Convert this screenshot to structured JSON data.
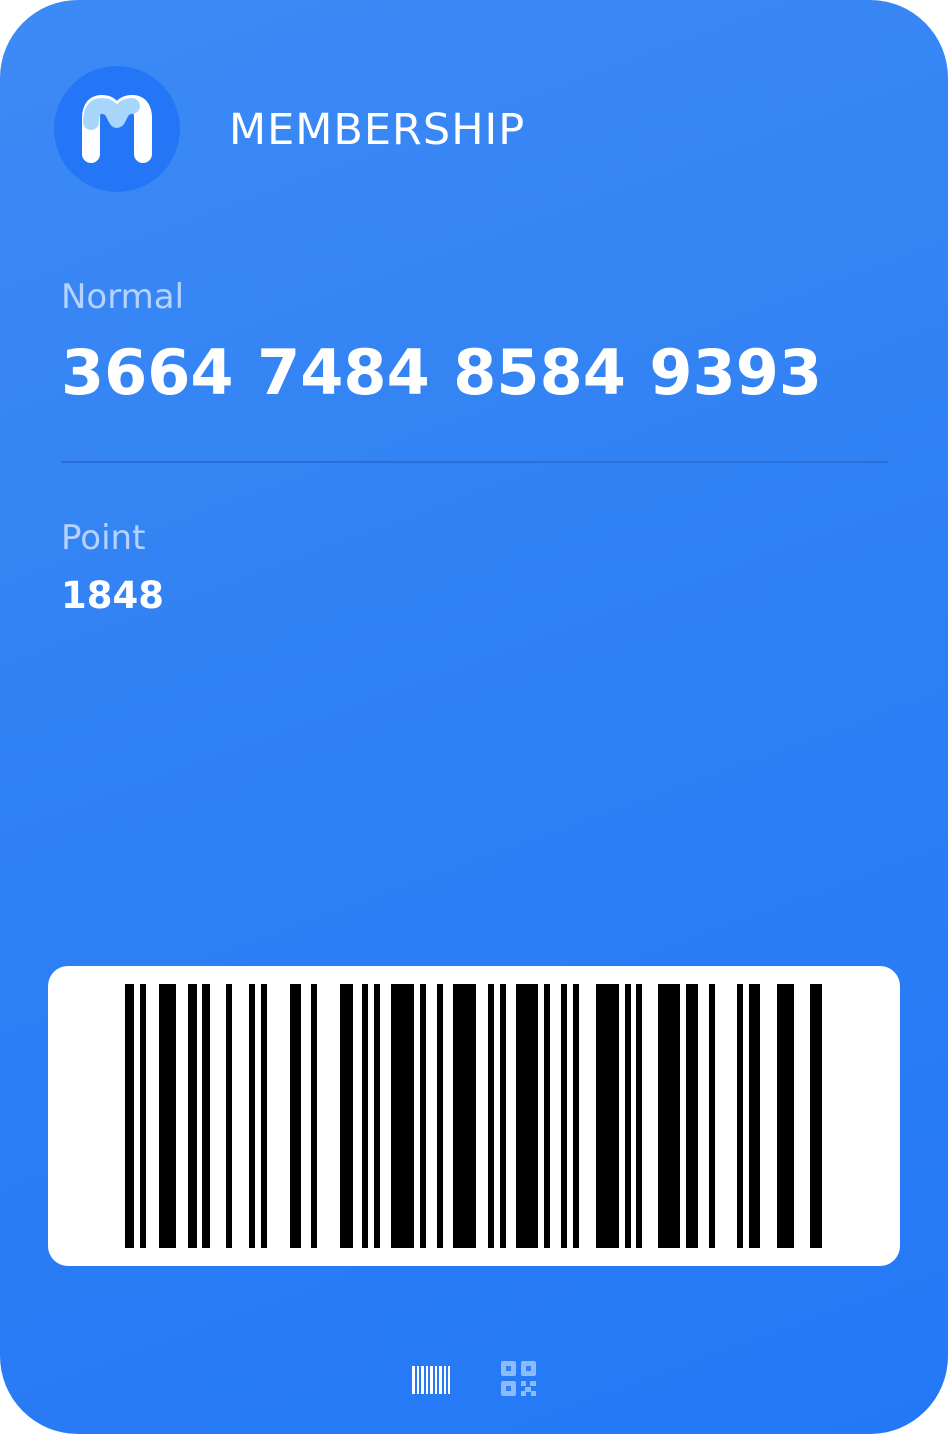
{
  "card": {
    "title": "MEMBERSHIP",
    "logo_icon": "membership-m-logo",
    "tier": "Normal",
    "number": "3664  7484  8584  9393",
    "point_label": "Point",
    "point_value": "1848"
  },
  "barcode": {
    "format": "1D barcode"
  },
  "code_switcher": {
    "options": [
      {
        "icon": "barcode-icon",
        "selected": true
      },
      {
        "icon": "qr-code-icon",
        "selected": false
      }
    ]
  },
  "colors": {
    "card_background": "#2f80f4",
    "logo_background": "#2476f6",
    "muted_text": "#b5d3ff",
    "text": "#ffffff"
  }
}
